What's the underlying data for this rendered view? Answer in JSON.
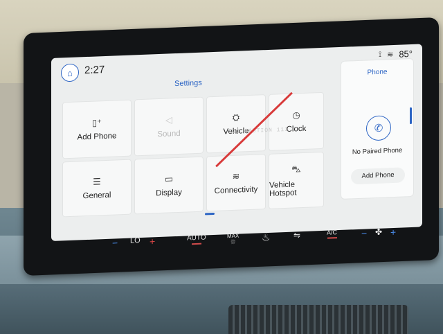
{
  "header": {
    "time": "2:27",
    "temperature": "85°"
  },
  "settings": {
    "title": "Settings",
    "tiles": [
      {
        "label": "Add Phone",
        "icon": "phone-add-icon",
        "enabled": true
      },
      {
        "label": "Sound",
        "icon": "speaker-icon",
        "enabled": false
      },
      {
        "label": "Vehicle",
        "icon": "vehicle-settings-icon",
        "enabled": true
      },
      {
        "label": "Clock",
        "icon": "clock-icon",
        "enabled": true
      },
      {
        "label": "General",
        "icon": "sliders-icon",
        "enabled": true
      },
      {
        "label": "Display",
        "icon": "display-icon",
        "enabled": true
      },
      {
        "label": "Connectivity",
        "icon": "wifi-icon",
        "enabled": true
      },
      {
        "label": "Vehicle Hotspot",
        "icon": "hotspot-car-icon",
        "enabled": true
      }
    ]
  },
  "phone_panel": {
    "title": "Phone",
    "status": "No Paired Phone",
    "button": "Add Phone"
  },
  "climate": {
    "left_temp": "LO",
    "auto": "AUTO",
    "max": "MAX",
    "ac": "A/C"
  },
  "colors": {
    "accent": "#2d65c4",
    "strike": "#d83a3a",
    "screen_bg": "#eceeee"
  }
}
